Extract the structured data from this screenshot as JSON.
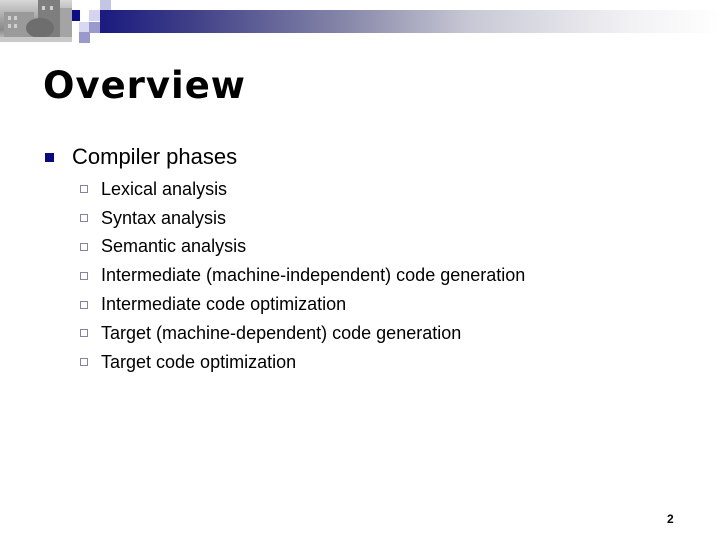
{
  "slide": {
    "title": "Overview",
    "bullet": "Compiler phases",
    "sub_items": [
      "Lexical analysis",
      "Syntax analysis",
      "Semantic analysis",
      "Intermediate (machine-independent) code generation",
      "Intermediate code optimization",
      "Target (machine-dependent) code generation",
      "Target code optimization"
    ],
    "page_number": "2"
  },
  "theme": {
    "accent_dark": "#1a1a80",
    "accent_mid": "#8888cc",
    "accent_light": "#c8c8e8",
    "bullet_color": "#0a0a7a",
    "sub_bullet_color": "#8484a6"
  }
}
